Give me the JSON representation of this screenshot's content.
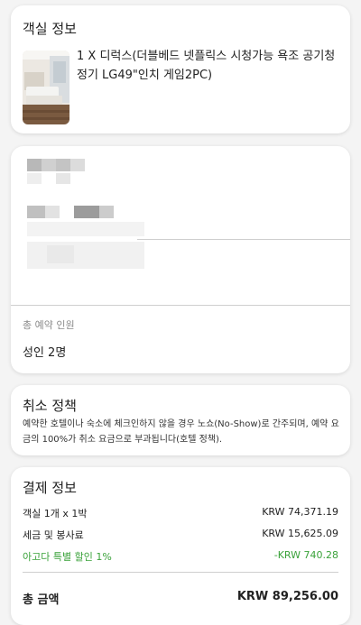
{
  "room_info": {
    "title": "객실 정보",
    "room_name": "1 X 디럭스(더블베드 넷플릭스 시청가능 욕조 공기청정기 LG49\"인치 게임2PC)"
  },
  "guest_info": {
    "total_guests_label": "총 예약 인원",
    "total_guests_value": "성인 2명"
  },
  "cancel_policy": {
    "title": "취소 정책",
    "text": "예약한 호텔이나 숙소에 체크인하지 않을 경우 노쇼(No-Show)로 간주되며, 예약 요금의 100%가 취소 요금으로 부과됩니다(호텔 정책)."
  },
  "payment": {
    "title": "결제 정보",
    "rows": [
      {
        "label": "객실 1개 x 1박",
        "value": "KRW 74,371.19"
      },
      {
        "label": "세금 및 봉사료",
        "value": "KRW 15,625.09"
      },
      {
        "label": "아고다 특별 할인 1%",
        "value": "-KRW 740.28"
      }
    ],
    "total_label": "총 금액",
    "total_value": "KRW 89,256.00"
  },
  "colors": {
    "discount": "#3aa23a",
    "card_bg": "#ffffff",
    "page_bg": "#f4f4f4"
  }
}
